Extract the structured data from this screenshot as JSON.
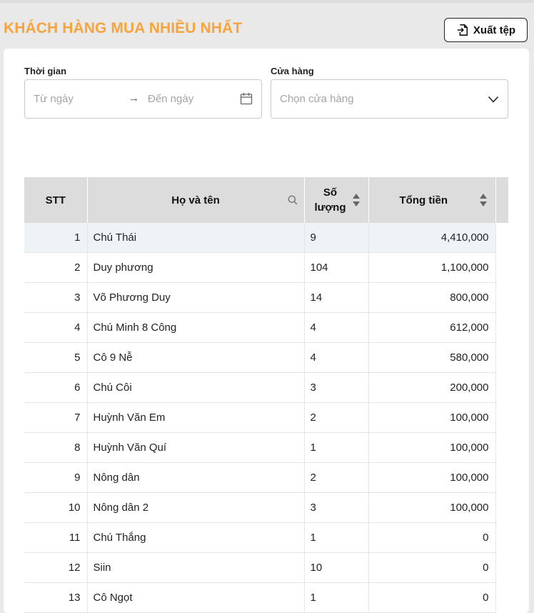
{
  "page": {
    "title": "KHÁCH HÀNG MUA NHIỀU NHẤT"
  },
  "toolbar": {
    "export_label": "Xuất tệp"
  },
  "filters": {
    "time_label": "Thời gian",
    "from_placeholder": "Từ ngày",
    "to_placeholder": "Đến ngày",
    "arrow": "→",
    "store_label": "Cửa hàng",
    "store_placeholder": "Chọn cửa hàng"
  },
  "table": {
    "columns": {
      "stt": "STT",
      "name": "Họ và tên",
      "qty": "Số lượng",
      "total": "Tổng tiền"
    },
    "rows": [
      {
        "stt": "1",
        "name": "Chú Thái",
        "qty": "9",
        "total": "4,410,000"
      },
      {
        "stt": "2",
        "name": "Duy phương",
        "qty": "104",
        "total": "1,100,000"
      },
      {
        "stt": "3",
        "name": "Võ Phương Duy",
        "qty": "14",
        "total": "800,000"
      },
      {
        "stt": "4",
        "name": "Chú Minh 8 Công",
        "qty": "4",
        "total": "612,000"
      },
      {
        "stt": "5",
        "name": "Cô 9 Nễ",
        "qty": "4",
        "total": "580,000"
      },
      {
        "stt": "6",
        "name": "Chú Côi",
        "qty": "3",
        "total": "200,000"
      },
      {
        "stt": "7",
        "name": "Huỳnh Văn Em",
        "qty": "2",
        "total": "100,000"
      },
      {
        "stt": "8",
        "name": "Huỳnh Văn Quí",
        "qty": "1",
        "total": "100,000"
      },
      {
        "stt": "9",
        "name": "Nông dân",
        "qty": "2",
        "total": "100,000"
      },
      {
        "stt": "10",
        "name": "Nông dân 2",
        "qty": "3",
        "total": "100,000"
      },
      {
        "stt": "11",
        "name": "Chú Thắng",
        "qty": "1",
        "total": "0"
      },
      {
        "stt": "12",
        "name": "Siin",
        "qty": "10",
        "total": "0"
      },
      {
        "stt": "13",
        "name": "Cô Ngọt",
        "qty": "1",
        "total": "0"
      }
    ]
  },
  "colors": {
    "title": "#f7a43c",
    "header_bg": "#dcdcdc",
    "highlight_row": "#eef3f8"
  },
  "icons": {
    "export": "file-export-icon",
    "calendar": "calendar-icon",
    "dropdown": "chevron-down-icon",
    "search": "search-icon",
    "sort": "sort-icon"
  }
}
